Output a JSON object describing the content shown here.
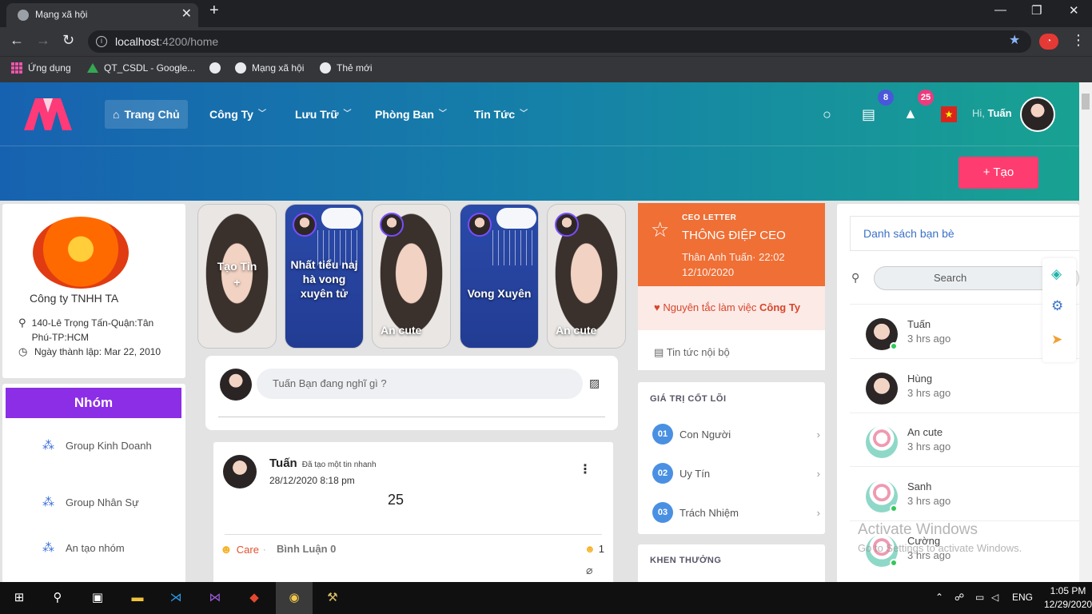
{
  "browser": {
    "tab_title": "Mạng xã hội",
    "new_tab": "+",
    "url_host": "localhost",
    "url_path": ":4200/home",
    "bookmarks": [
      "Ứng dụng",
      "QT_CSDL - Google...",
      "Mạng xã hội",
      "Thẻ mới"
    ]
  },
  "header": {
    "menu": [
      {
        "label": "Trang Chủ",
        "active": true
      },
      {
        "label": "Công Ty"
      },
      {
        "label": "Lưu Trữ"
      },
      {
        "label": "Phòng Ban"
      },
      {
        "label": "Tin Tức"
      }
    ],
    "messages_badge": "8",
    "notifications_badge": "25",
    "greeting": "Hi,",
    "user_name": "Tuấn",
    "create_label": "+ Tạo",
    "colors": {
      "accent": "#ff3c6f",
      "badge_blue": "#4b57d9",
      "badge_pink": "#f03a7e"
    }
  },
  "company": {
    "name": "Công ty TNHH TA",
    "address": "140-Lê Trọng Tấn-Quận:Tân Phú-TP:HCM",
    "founded": "Ngày thành lập: Mar 22, 2010"
  },
  "groups": {
    "title": "Nhóm",
    "items": [
      "Group Kinh Doanh",
      "Group Nhân Sự",
      "An tạo nhóm"
    ]
  },
  "stories": [
    {
      "label": "Tạo Tin",
      "sub": "+",
      "kind": "photo"
    },
    {
      "label": "Nhất tiểu naj hà vong xuyên tử",
      "kind": "blue"
    },
    {
      "label": "An cute",
      "kind": "photo"
    },
    {
      "label": "Vong Xuyên",
      "kind": "blue"
    },
    {
      "label": "An cute",
      "kind": "photo"
    }
  ],
  "composer": {
    "placeholder": "Tuấn  Bạn đang nghĩ gì ?"
  },
  "post": {
    "author": "Tuấn",
    "action": "Đã tạo một tin nhanh",
    "time": "28/12/2020 8:18 pm",
    "content": "25",
    "reaction": "Care",
    "separator": "·",
    "comments": "Bình Luận 0",
    "reaction_count": "1"
  },
  "ceo": {
    "tag": "CEO LETTER",
    "title": "THÔNG ĐIỆP CEO",
    "meta_line1": "Thân Anh Tuấn· 22:02",
    "meta_line2": "12/10/2020",
    "principle_prefix": "Nguyên tắc làm việc",
    "principle_bold": "Công Ty",
    "news": "Tin tức nội bộ"
  },
  "core_values": {
    "title": "GIÁ TRỊ CỐT LÕI",
    "items": [
      {
        "num": "01",
        "label": "Con Người"
      },
      {
        "num": "02",
        "label": "Uy Tín"
      },
      {
        "num": "03",
        "label": "Trách Nhiệm"
      }
    ]
  },
  "rewards": {
    "title": "KHEN THƯỞNG"
  },
  "friends": {
    "title": "Danh sách bạn bè",
    "search_placeholder": "Search",
    "items": [
      {
        "name": "Tuấn",
        "time": "3 hrs ago",
        "online": true,
        "avatar": "photo"
      },
      {
        "name": "Hùng",
        "time": "3 hrs ago",
        "online": false,
        "avatar": "photo"
      },
      {
        "name": "An cute",
        "time": "3 hrs ago",
        "online": false,
        "avatar": "generic"
      },
      {
        "name": "Sanh",
        "time": "3 hrs ago",
        "online": true,
        "avatar": "generic"
      },
      {
        "name": "Cường",
        "time": "3 hrs ago",
        "online": true,
        "avatar": "generic"
      }
    ]
  },
  "watermark": {
    "line1": "Activate Windows",
    "line2": "Go to Settings to activate Windows."
  },
  "taskbar": {
    "lang": "ENG",
    "time": "1:05 PM",
    "date": "12/29/2020"
  }
}
